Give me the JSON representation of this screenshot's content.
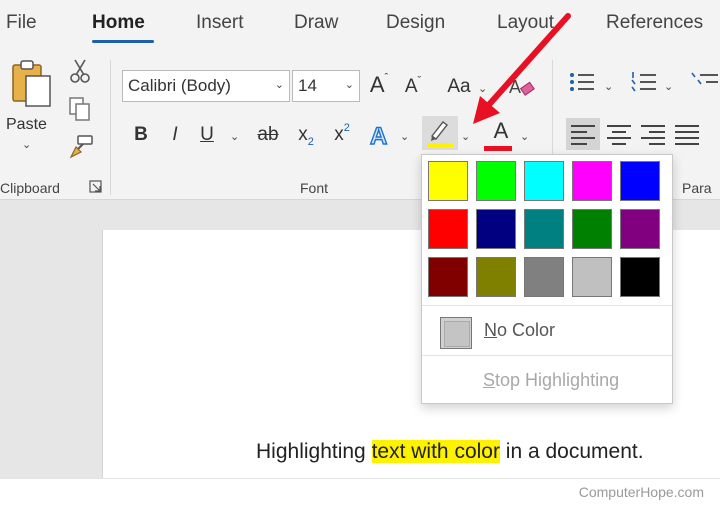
{
  "tabs": [
    {
      "label": "File"
    },
    {
      "label": "Home",
      "active": true
    },
    {
      "label": "Insert"
    },
    {
      "label": "Draw"
    },
    {
      "label": "Design"
    },
    {
      "label": "Layout"
    },
    {
      "label": "References"
    }
  ],
  "clipboard": {
    "paste_label": "Paste",
    "group_label": "Clipboard"
  },
  "font": {
    "font_name": "Calibri (Body)",
    "font_size": "14",
    "grow_label": "A",
    "shrink_label": "A",
    "case_label": "Aa",
    "bold_label": "B",
    "italic_label": "I",
    "underline_label": "U",
    "strike_label": "ab",
    "subscript_label": "x",
    "subscript_mark": "2",
    "superscript_label": "x",
    "superscript_mark": "2",
    "font_color_label": "A",
    "group_label": "Font"
  },
  "paragraph": {
    "group_label": "Para"
  },
  "highlight_menu": {
    "colors": [
      "#ffff00",
      "#00ff00",
      "#00ffff",
      "#ff00ff",
      "#0000ff",
      "#ff0000",
      "#000080",
      "#008080",
      "#008000",
      "#800080",
      "#800000",
      "#808000",
      "#808080",
      "#c0c0c0",
      "#000000"
    ],
    "no_color_label": "No Color",
    "stop_label": "Stop Highlighting"
  },
  "document": {
    "text_before": "Highlighting ",
    "text_highlighted": "text with color",
    "text_after": " in a document."
  },
  "watermark": "ComputerHope.com",
  "colors": {
    "highlight": "#fff200",
    "font_color": "#e81123",
    "arrow": "#e81123",
    "accent": "#1f5fa8"
  }
}
